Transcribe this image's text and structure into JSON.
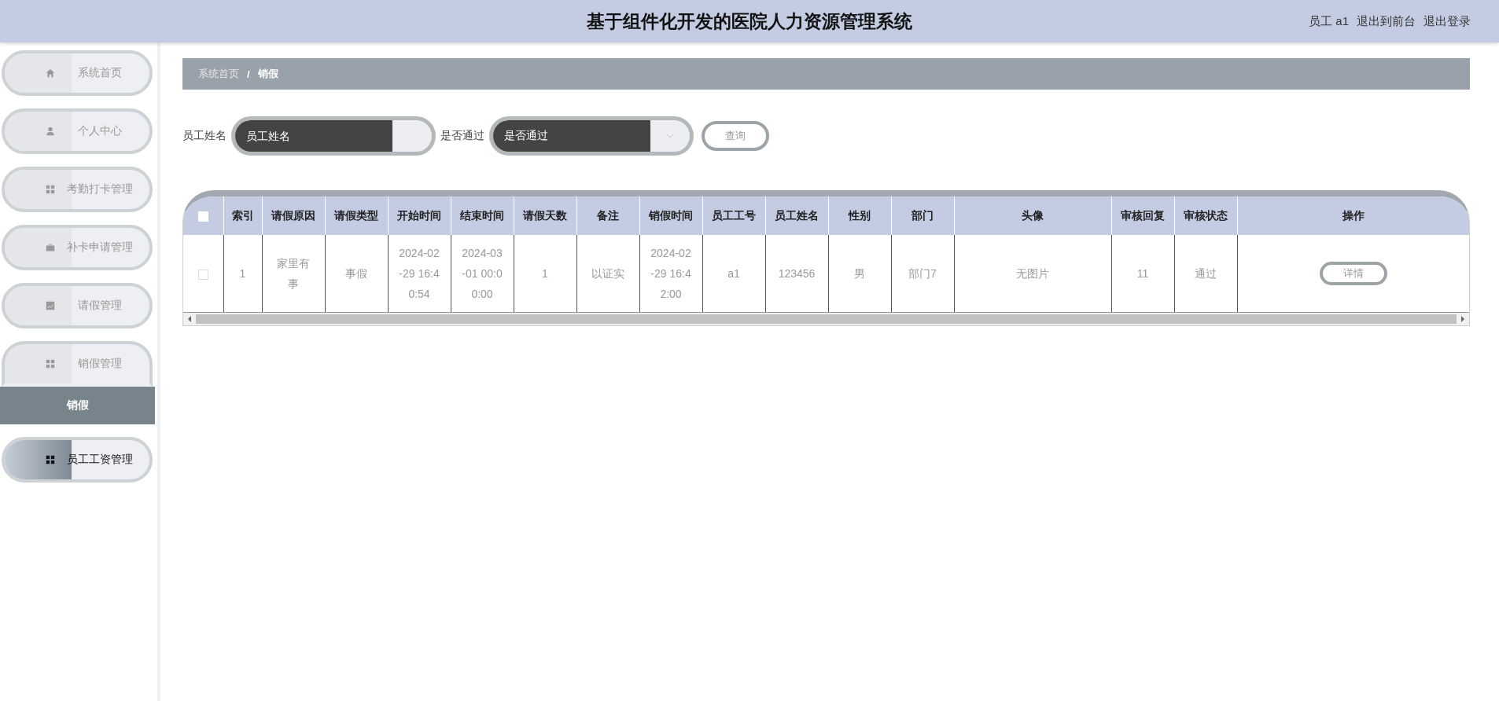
{
  "header": {
    "title": "基于组件化开发的医院人力资源管理系统",
    "user": "员工 a1",
    "links": [
      "退出到前台",
      "退出登录"
    ]
  },
  "sidebar": {
    "items": [
      {
        "label": "系统首页",
        "selected": false,
        "hover": false
      },
      {
        "label": "个人中心",
        "selected": false,
        "hover": false
      },
      {
        "label": "考勤打卡管理",
        "selected": false,
        "hover": false
      },
      {
        "label": "补卡申请管理",
        "selected": false,
        "hover": false
      },
      {
        "label": "请假管理",
        "selected": false,
        "hover": false
      },
      {
        "label": "销假管理",
        "selected": true,
        "hover": false,
        "children": [
          {
            "label": "销假",
            "selected": true
          }
        ]
      },
      {
        "label": "员工工资管理",
        "selected": false,
        "hover": true
      }
    ]
  },
  "breadcrumb": {
    "items": [
      "系统首页",
      "销假"
    ],
    "separator": "/"
  },
  "search": {
    "fields": [
      {
        "label": "员工姓名",
        "kind": "input",
        "placeholder": "员工姓名"
      },
      {
        "label": "是否通过",
        "kind": "select",
        "placeholder": "是否通过"
      }
    ],
    "button": "查询"
  },
  "table": {
    "header_checkbox": {
      "checked": false
    },
    "columns": [
      "索引",
      "请假原因",
      "请假类型",
      "开始时间",
      "结束时间",
      "请假天数",
      "备注",
      "销假时间",
      "员工工号",
      "员工姓名",
      "性别",
      "部门",
      "头像",
      "审核回复",
      "审核状态",
      "操作"
    ],
    "rows": [
      {
        "checked": false,
        "cells": [
          "1",
          "家里有事",
          "事假",
          "2024-02-29 16:40:54",
          "2024-03-01 00:00:00",
          "1",
          "以证实",
          "2024-02-29 16:42:00",
          "a1",
          "123456",
          "男",
          "部门7",
          "无图片",
          "11",
          "通过"
        ],
        "action": "详情"
      }
    ]
  }
}
